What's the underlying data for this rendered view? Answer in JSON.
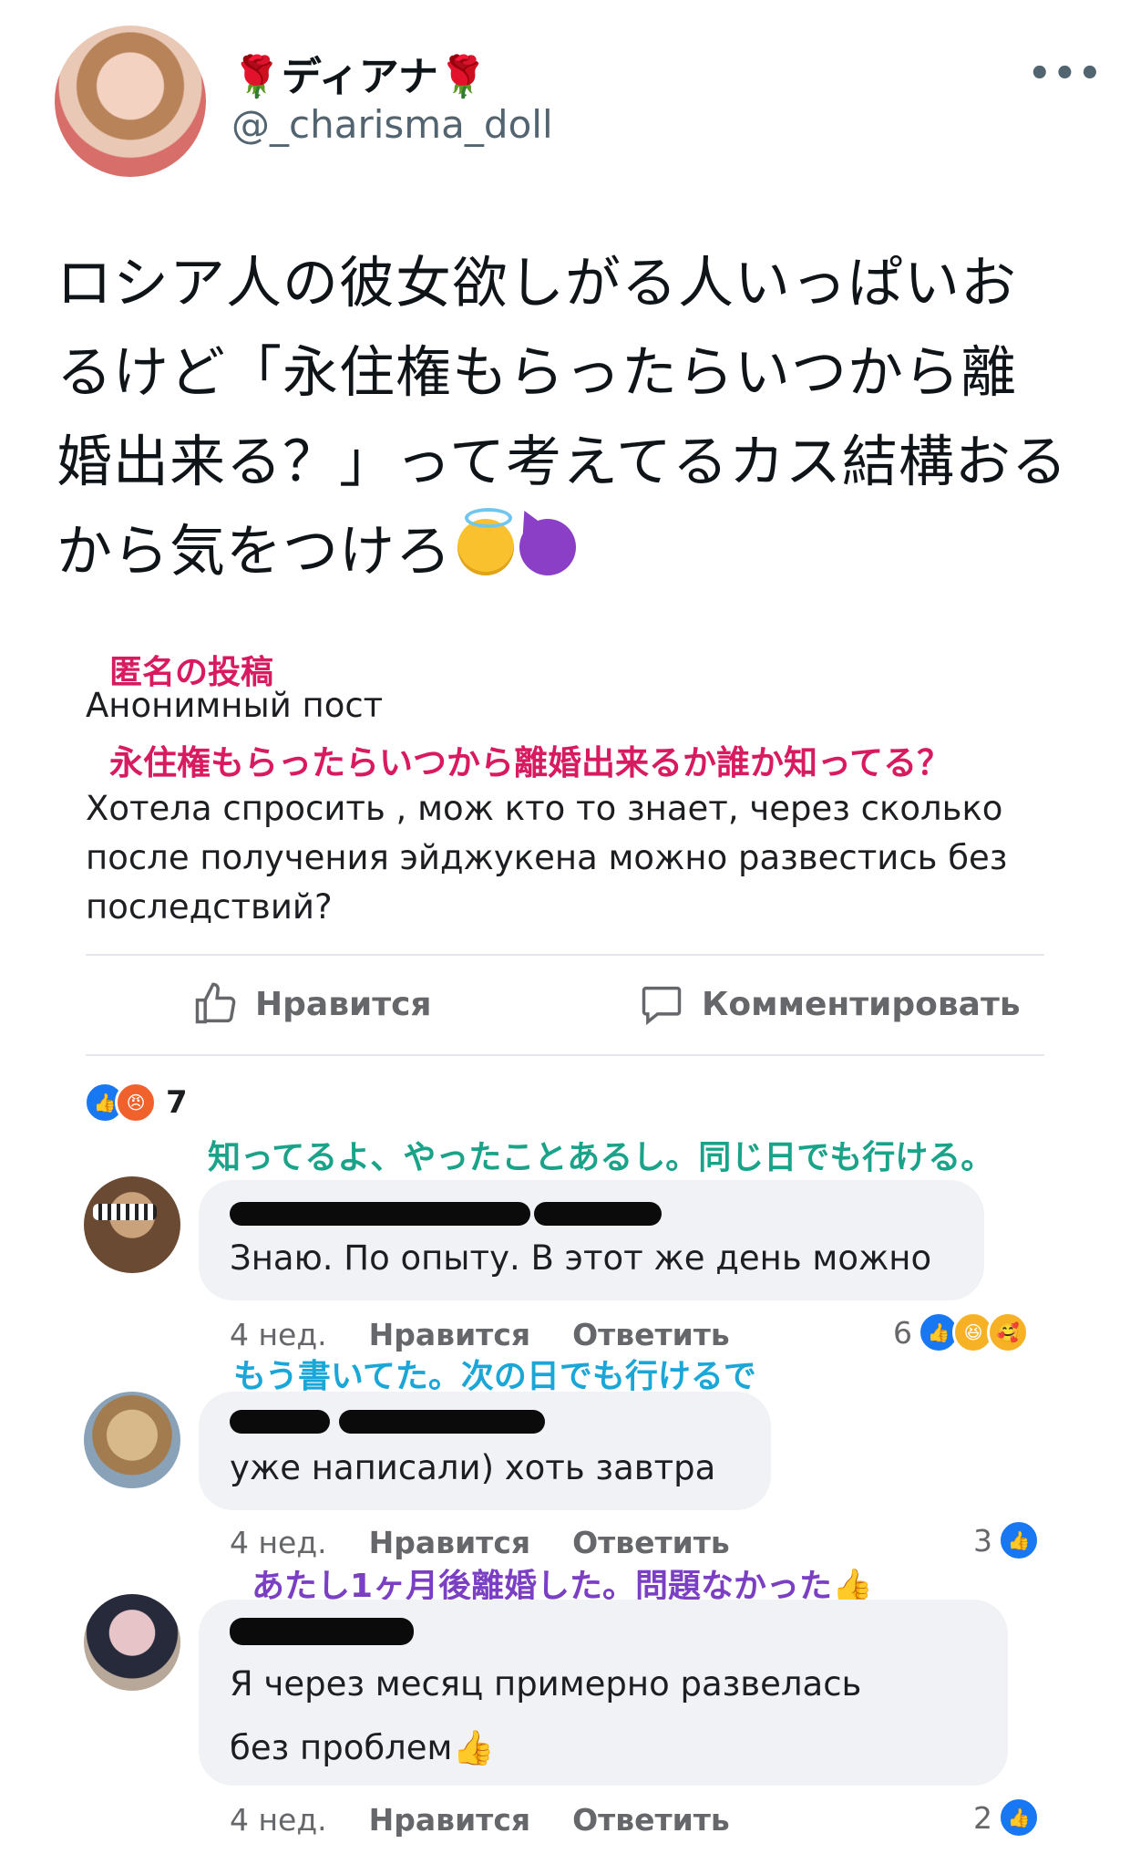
{
  "tweet": {
    "display_name": "ディアナ",
    "name_emoji": "🌹",
    "handle": "@_charisma_doll",
    "more_label": "•••",
    "text": "ロシア人の彼女欲しがる人いっぱいおるけど「永住権もらったらいつから離婚出来る？」って考えてるカス結構おるから気をつけろ"
  },
  "fb_post": {
    "title_jp": "匿名の投稿",
    "title_ru": "Анонимный пост",
    "question_jp": "永住権もらったらいつから離婚出来るか誰か知ってる？",
    "body_ru": "Хотела спросить , мож кто то знает, через сколько после получения эйджукена можно развестись без последствий?",
    "like_label": "Нравится",
    "comment_label": "Комментировать",
    "reaction_count": "7"
  },
  "comments": [
    {
      "note_jp": "知ってるよ、やったことあるし。同じ日でも行ける。",
      "text": "Знаю. По опыту. В этот же день можно",
      "time": "4 нед.",
      "like": "Нравится",
      "reply": "Ответить",
      "reactions": "6"
    },
    {
      "note_jp": "もう書いてた。次の日でも行けるで",
      "text": "уже написали) хоть завтра",
      "time": "4 нед.",
      "like": "Нравится",
      "reply": "Ответить",
      "reactions": "3"
    },
    {
      "note_jp": "あたし1ヶ月後離婚した。問題なかった👍",
      "text": "Я через месяц примерно развелась без проблем👍",
      "time": "4 нед.",
      "like": "Нравится",
      "reply": "Ответить",
      "reactions": "2"
    }
  ],
  "colors": {
    "pink_note": "#d81b60",
    "green_note": "#1aa389",
    "blue_note": "#1aa7d8",
    "purple_note": "#7b3fc4",
    "fb_blue": "#1877f2"
  }
}
